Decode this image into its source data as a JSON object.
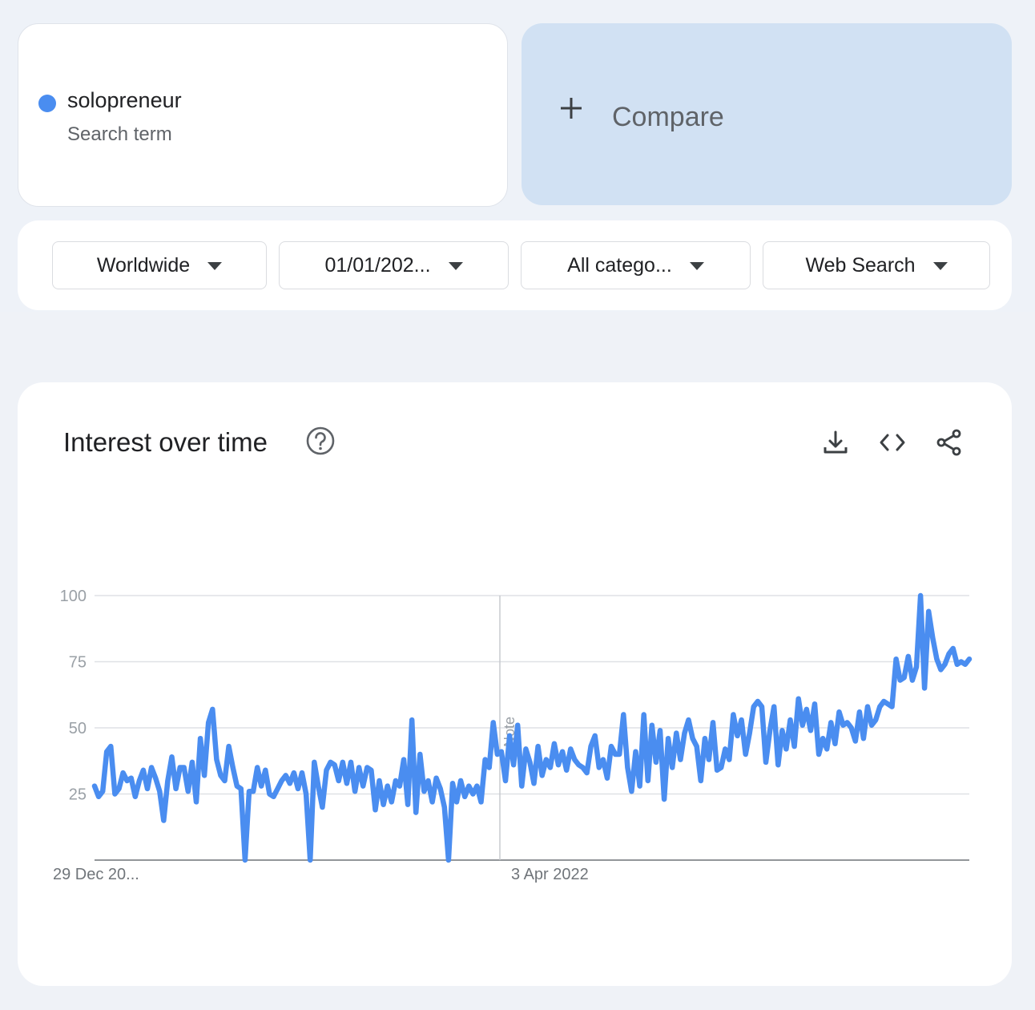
{
  "search_term": {
    "name": "solopreneur",
    "type": "Search term",
    "color": "#4a8df0"
  },
  "compare": {
    "label": "Compare",
    "background": "#d1e1f3"
  },
  "filters": [
    {
      "label": "Worldwide"
    },
    {
      "label": "01/01/202..."
    },
    {
      "label": "All catego..."
    },
    {
      "label": "Web Search"
    }
  ],
  "chart_card": {
    "title": "Interest over time",
    "icons": [
      "help-icon",
      "download-icon",
      "embed-code-icon",
      "share-icon"
    ]
  },
  "chart_data": {
    "type": "line",
    "title": "Interest over time",
    "xlabel": "",
    "ylabel": "",
    "ylim": [
      0,
      100
    ],
    "yticks": [
      25,
      50,
      75,
      100
    ],
    "x_tick_labels": [
      "29 Dec 20...",
      "3 Apr 2022"
    ],
    "annotation": "Note",
    "line_color": "#4a8df0",
    "grid": true,
    "series": [
      {
        "values": [
          28,
          24,
          26,
          41,
          43,
          25,
          27,
          33,
          30,
          31,
          24,
          30,
          34,
          27,
          35,
          31,
          26,
          15,
          30,
          39,
          27,
          35,
          35,
          26,
          37,
          22,
          46,
          32,
          52,
          57,
          38,
          32,
          30,
          43,
          35,
          28,
          27,
          0,
          26,
          26,
          35,
          28,
          34,
          25,
          24,
          27,
          30,
          32,
          29,
          33,
          27,
          33,
          25,
          0,
          37,
          28,
          20,
          34,
          37,
          36,
          30,
          37,
          29,
          37,
          26,
          35,
          28,
          35,
          34,
          19,
          30,
          21,
          28,
          22,
          30,
          28,
          38,
          21,
          53,
          18,
          40,
          26,
          30,
          22,
          31,
          27,
          20,
          0,
          29,
          22,
          30,
          24,
          28,
          25,
          28,
          22,
          38,
          35,
          52,
          40,
          41,
          30,
          47,
          36,
          51,
          28,
          42,
          37,
          29,
          43,
          32,
          38,
          35,
          44,
          36,
          41,
          34,
          42,
          38,
          36,
          35,
          33,
          43,
          47,
          35,
          38,
          31,
          43,
          40,
          40,
          55,
          35,
          26,
          41,
          28,
          55,
          30,
          51,
          37,
          49,
          23,
          46,
          35,
          48,
          38,
          48,
          53,
          46,
          43,
          30,
          46,
          38,
          52,
          34,
          35,
          42,
          38,
          55,
          47,
          53,
          40,
          48,
          58,
          60,
          58,
          37,
          49,
          58,
          36,
          49,
          42,
          53,
          43,
          61,
          51,
          57,
          49,
          59,
          40,
          46,
          42,
          52,
          44,
          56,
          51,
          52,
          50,
          45,
          56,
          46,
          58,
          51,
          53,
          58,
          60,
          59,
          58,
          76,
          68,
          69,
          77,
          68,
          73,
          100,
          65,
          94,
          84,
          76,
          72,
          74,
          78,
          80,
          74,
          75,
          74,
          76
        ]
      }
    ]
  }
}
